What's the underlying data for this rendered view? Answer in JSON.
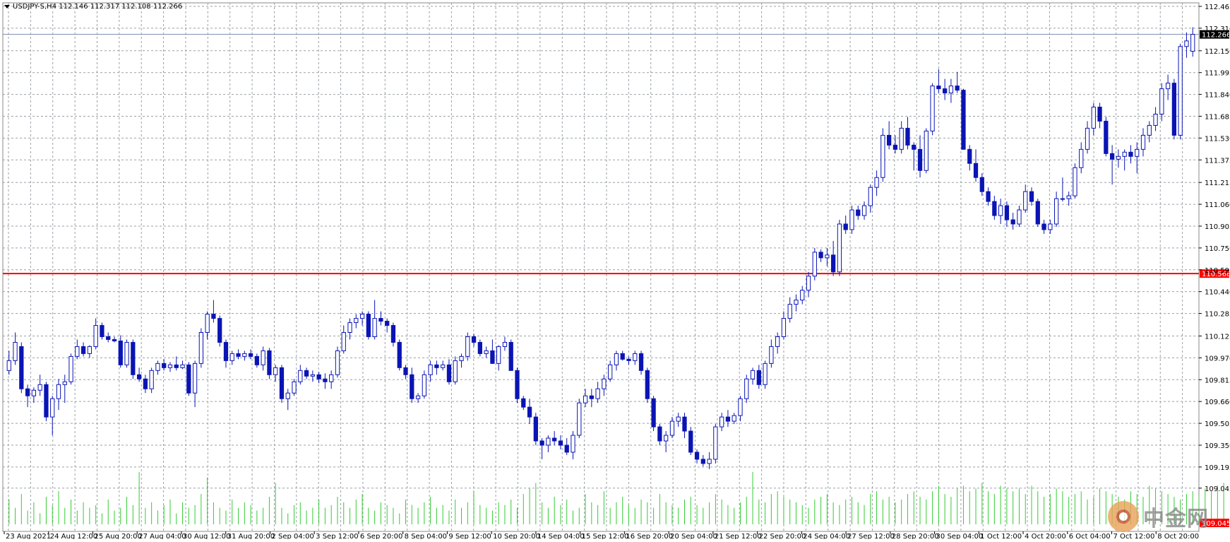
{
  "header": {
    "symbol_line": "USDJPY-S,H4  112.146 112.317 112.108 112.266"
  },
  "watermark": {
    "text": "中金网"
  },
  "colors": {
    "candle": "#0a14b4",
    "grid": "#9aa0a6",
    "hline": "#ff0000",
    "volume": "#33cc33",
    "current_tag_bg": "#000000",
    "hline_tag_bg": "#ff0000"
  },
  "chart_data": {
    "type": "candlestick",
    "symbol": "USDJPY-S",
    "timeframe": "H4",
    "ylim": [
      109.2,
      112.465
    ],
    "y_ticks": [
      112.465,
      112.31,
      112.15,
      111.995,
      111.84,
      111.685,
      111.53,
      111.375,
      111.215,
      111.06,
      110.905,
      110.75,
      110.595,
      110.44,
      110.285,
      110.125,
      109.97,
      109.815,
      109.66,
      109.505,
      109.35,
      109.195,
      109.045
    ],
    "x_labels": [
      "23 Aug 2021",
      "24 Aug 12:00",
      "25 Aug 20:00",
      "27 Aug 04:00",
      "30 Aug 12:00",
      "31 Aug 20:00",
      "2 Sep 04:00",
      "3 Sep 12:00",
      "6 Sep 20:00",
      "8 Sep 04:00",
      "9 Sep 12:00",
      "10 Sep 20:00",
      "14 Sep 04:00",
      "15 Sep 12:00",
      "16 Sep 20:00",
      "20 Sep 04:00",
      "21 Sep 12:00",
      "22 Sep 20:00",
      "24 Sep 04:00",
      "27 Sep 12:00",
      "28 Sep 20:00",
      "30 Sep 04:00",
      "1 Oct 12:00",
      "4 Oct 20:00",
      "6 Oct 04:00",
      "7 Oct 12:00",
      "8 Oct 20:00"
    ],
    "current_price": 112.266,
    "horizontal_line": 110.568,
    "volume_axis_label": "109.045",
    "candles": [
      [
        109.88,
        110.02,
        109.85,
        109.95
      ],
      [
        109.95,
        110.15,
        109.92,
        110.08
      ],
      [
        110.05,
        110.08,
        109.72,
        109.75
      ],
      [
        109.75,
        109.78,
        109.62,
        109.7
      ],
      [
        109.7,
        109.76,
        109.65,
        109.74
      ],
      [
        109.74,
        109.85,
        109.7,
        109.78
      ],
      [
        109.78,
        109.8,
        109.52,
        109.55
      ],
      [
        109.55,
        109.7,
        109.42,
        109.68
      ],
      [
        109.68,
        109.82,
        109.6,
        109.78
      ],
      [
        109.78,
        109.85,
        109.65,
        109.8
      ],
      [
        109.8,
        110.0,
        109.78,
        109.98
      ],
      [
        109.98,
        110.1,
        109.96,
        110.05
      ],
      [
        110.05,
        110.08,
        109.98,
        110.0
      ],
      [
        110.0,
        110.06,
        109.97,
        110.05
      ],
      [
        110.05,
        110.25,
        110.03,
        110.2
      ],
      [
        110.2,
        110.22,
        110.1,
        110.12
      ],
      [
        110.12,
        110.15,
        110.08,
        110.1
      ],
      [
        110.1,
        110.12,
        110.08,
        110.09
      ],
      [
        110.09,
        110.13,
        109.9,
        109.92
      ],
      [
        109.92,
        110.1,
        109.9,
        110.08
      ],
      [
        110.08,
        110.1,
        109.82,
        109.85
      ],
      [
        109.85,
        109.9,
        109.8,
        109.82
      ],
      [
        109.82,
        109.85,
        109.72,
        109.75
      ],
      [
        109.75,
        109.9,
        109.72,
        109.88
      ],
      [
        109.88,
        109.95,
        109.85,
        109.93
      ],
      [
        109.93,
        109.96,
        109.88,
        109.9
      ],
      [
        109.9,
        109.94,
        109.87,
        109.92
      ],
      [
        109.92,
        109.98,
        109.88,
        109.9
      ],
      [
        109.9,
        109.95,
        109.89,
        109.92
      ],
      [
        109.92,
        109.94,
        109.7,
        109.72
      ],
      [
        109.72,
        109.95,
        109.62,
        109.93
      ],
      [
        109.93,
        110.18,
        109.9,
        110.15
      ],
      [
        110.15,
        110.3,
        110.1,
        110.28
      ],
      [
        110.28,
        110.38,
        110.22,
        110.25
      ],
      [
        110.25,
        110.27,
        110.05,
        110.08
      ],
      [
        110.08,
        110.1,
        109.9,
        109.95
      ],
      [
        109.95,
        110.02,
        109.92,
        110.0
      ],
      [
        110.0,
        110.03,
        109.96,
        109.98
      ],
      [
        109.98,
        110.02,
        109.95,
        110.0
      ],
      [
        110.0,
        110.03,
        109.96,
        109.98
      ],
      [
        109.98,
        110.0,
        109.9,
        109.92
      ],
      [
        109.92,
        110.05,
        109.88,
        110.02
      ],
      [
        110.02,
        110.04,
        109.82,
        109.85
      ],
      [
        109.85,
        109.92,
        109.8,
        109.9
      ],
      [
        109.9,
        109.92,
        109.65,
        109.68
      ],
      [
        109.68,
        109.75,
        109.6,
        109.72
      ],
      [
        109.72,
        109.82,
        109.7,
        109.8
      ],
      [
        109.8,
        109.92,
        109.78,
        109.88
      ],
      [
        109.88,
        109.9,
        109.82,
        109.84
      ],
      [
        109.84,
        109.88,
        109.8,
        109.85
      ],
      [
        109.85,
        109.87,
        109.79,
        109.82
      ],
      [
        109.82,
        109.86,
        109.75,
        109.8
      ],
      [
        109.8,
        109.88,
        109.75,
        109.85
      ],
      [
        109.85,
        110.05,
        109.83,
        110.02
      ],
      [
        110.02,
        110.2,
        110.0,
        110.15
      ],
      [
        110.15,
        110.25,
        110.1,
        110.22
      ],
      [
        110.22,
        110.28,
        110.18,
        110.25
      ],
      [
        110.25,
        110.3,
        110.2,
        110.28
      ],
      [
        110.28,
        110.3,
        110.1,
        110.12
      ],
      [
        110.12,
        110.38,
        110.1,
        110.25
      ],
      [
        110.25,
        110.3,
        110.2,
        110.23
      ],
      [
        110.23,
        110.25,
        110.15,
        110.2
      ],
      [
        110.2,
        110.22,
        110.05,
        110.08
      ],
      [
        110.08,
        110.1,
        109.88,
        109.9
      ],
      [
        109.9,
        109.92,
        109.82,
        109.85
      ],
      [
        109.85,
        109.9,
        109.65,
        109.68
      ],
      [
        109.68,
        109.72,
        109.65,
        109.7
      ],
      [
        109.7,
        109.88,
        109.68,
        109.85
      ],
      [
        109.85,
        109.95,
        109.8,
        109.92
      ],
      [
        109.92,
        109.95,
        109.85,
        109.9
      ],
      [
        109.9,
        109.95,
        109.88,
        109.92
      ],
      [
        109.92,
        109.96,
        109.78,
        109.8
      ],
      [
        109.8,
        109.98,
        109.78,
        109.95
      ],
      [
        109.95,
        110.0,
        109.9,
        109.98
      ],
      [
        109.98,
        110.15,
        109.95,
        110.12
      ],
      [
        110.12,
        110.14,
        110.05,
        110.08
      ],
      [
        110.08,
        110.1,
        109.98,
        110.0
      ],
      [
        110.0,
        110.05,
        109.97,
        110.02
      ],
      [
        110.02,
        110.1,
        109.95,
        109.93
      ],
      [
        109.93,
        110.06,
        109.88,
        110.05
      ],
      [
        110.05,
        110.12,
        110.02,
        110.08
      ],
      [
        110.08,
        110.1,
        109.95,
        109.88
      ],
      [
        109.88,
        109.9,
        109.65,
        109.68
      ],
      [
        109.68,
        109.7,
        109.6,
        109.62
      ],
      [
        109.62,
        109.68,
        109.5,
        109.55
      ],
      [
        109.55,
        109.58,
        109.35,
        109.38
      ],
      [
        109.38,
        109.4,
        109.25,
        109.35
      ],
      [
        109.35,
        109.42,
        109.3,
        109.4
      ],
      [
        109.4,
        109.45,
        109.35,
        109.38
      ],
      [
        109.38,
        109.42,
        109.32,
        109.35
      ],
      [
        109.35,
        109.4,
        109.28,
        109.3
      ],
      [
        109.3,
        109.45,
        109.25,
        109.42
      ],
      [
        109.42,
        109.68,
        109.4,
        109.65
      ],
      [
        109.65,
        109.75,
        109.62,
        109.7
      ],
      [
        109.7,
        109.75,
        109.62,
        109.68
      ],
      [
        109.68,
        109.8,
        109.65,
        109.75
      ],
      [
        109.75,
        109.85,
        109.7,
        109.82
      ],
      [
        109.82,
        109.95,
        109.8,
        109.92
      ],
      [
        109.92,
        110.02,
        109.88,
        110.0
      ],
      [
        110.0,
        110.02,
        109.95,
        109.96
      ],
      [
        109.96,
        109.98,
        109.92,
        109.95
      ],
      [
        109.95,
        110.02,
        109.92,
        110.0
      ],
      [
        110.0,
        110.02,
        109.85,
        109.88
      ],
      [
        109.88,
        109.9,
        109.65,
        109.68
      ],
      [
        109.68,
        109.7,
        109.45,
        109.48
      ],
      [
        109.48,
        109.5,
        109.35,
        109.38
      ],
      [
        109.38,
        109.45,
        109.3,
        109.42
      ],
      [
        109.42,
        109.55,
        109.4,
        109.52
      ],
      [
        109.52,
        109.58,
        109.48,
        109.55
      ],
      [
        109.55,
        109.58,
        109.4,
        109.45
      ],
      [
        109.45,
        109.48,
        109.28,
        109.3
      ],
      [
        109.3,
        109.32,
        109.22,
        109.25
      ],
      [
        109.25,
        109.28,
        109.2,
        109.22
      ],
      [
        109.22,
        109.3,
        109.18,
        109.25
      ],
      [
        109.25,
        109.5,
        109.22,
        109.48
      ],
      [
        109.48,
        109.58,
        109.45,
        109.55
      ],
      [
        109.55,
        109.6,
        109.48,
        109.52
      ],
      [
        109.52,
        109.58,
        109.5,
        109.56
      ],
      [
        109.56,
        109.7,
        109.52,
        109.68
      ],
      [
        109.68,
        109.85,
        109.65,
        109.82
      ],
      [
        109.82,
        109.9,
        109.78,
        109.88
      ],
      [
        109.88,
        109.92,
        109.75,
        109.78
      ],
      [
        109.78,
        109.95,
        109.75,
        109.93
      ],
      [
        109.93,
        110.1,
        109.9,
        110.05
      ],
      [
        110.05,
        110.15,
        110.0,
        110.12
      ],
      [
        110.12,
        110.3,
        110.1,
        110.25
      ],
      [
        110.25,
        110.4,
        110.22,
        110.35
      ],
      [
        110.35,
        110.42,
        110.3,
        110.38
      ],
      [
        110.38,
        110.48,
        110.35,
        110.45
      ],
      [
        110.45,
        110.58,
        110.4,
        110.55
      ],
      [
        110.55,
        110.75,
        110.52,
        110.72
      ],
      [
        110.72,
        110.74,
        110.65,
        110.68
      ],
      [
        110.68,
        110.75,
        110.62,
        110.7
      ],
      [
        110.7,
        110.8,
        110.55,
        110.58
      ],
      [
        110.58,
        110.95,
        110.55,
        110.92
      ],
      [
        110.92,
        110.98,
        110.85,
        110.88
      ],
      [
        110.88,
        111.05,
        110.85,
        111.02
      ],
      [
        111.02,
        111.05,
        110.95,
        110.98
      ],
      [
        110.98,
        111.08,
        110.95,
        111.05
      ],
      [
        111.05,
        111.2,
        111.0,
        111.18
      ],
      [
        111.18,
        111.3,
        111.12,
        111.25
      ],
      [
        111.25,
        111.6,
        111.22,
        111.55
      ],
      [
        111.55,
        111.65,
        111.45,
        111.48
      ],
      [
        111.48,
        111.55,
        111.42,
        111.45
      ],
      [
        111.45,
        111.65,
        111.42,
        111.6
      ],
      [
        111.6,
        111.68,
        111.45,
        111.48
      ],
      [
        111.48,
        111.5,
        111.3,
        111.45
      ],
      [
        111.45,
        111.55,
        111.25,
        111.3
      ],
      [
        111.3,
        111.6,
        111.28,
        111.58
      ],
      [
        111.58,
        111.92,
        111.55,
        111.9
      ],
      [
        111.9,
        112.02,
        111.85,
        111.88
      ],
      [
        111.88,
        111.95,
        111.8,
        111.85
      ],
      [
        111.85,
        111.95,
        111.78,
        111.9
      ],
      [
        111.9,
        112.0,
        111.85,
        111.87
      ],
      [
        111.87,
        111.88,
        111.5,
        111.45
      ],
      [
        111.45,
        111.48,
        111.3,
        111.35
      ],
      [
        111.35,
        111.45,
        111.22,
        111.25
      ],
      [
        111.25,
        111.28,
        111.12,
        111.15
      ],
      [
        111.15,
        111.18,
        111.05,
        111.08
      ],
      [
        111.08,
        111.12,
        110.95,
        110.98
      ],
      [
        110.98,
        111.1,
        110.92,
        111.05
      ],
      [
        111.05,
        111.08,
        110.9,
        110.95
      ],
      [
        110.95,
        111.0,
        110.88,
        110.92
      ],
      [
        110.92,
        111.05,
        110.9,
        111.02
      ],
      [
        111.02,
        111.2,
        111.0,
        111.15
      ],
      [
        111.15,
        111.18,
        111.05,
        111.08
      ],
      [
        111.08,
        111.1,
        110.9,
        110.92
      ],
      [
        110.92,
        110.95,
        110.85,
        110.88
      ],
      [
        110.88,
        110.95,
        110.85,
        110.92
      ],
      [
        110.92,
        111.15,
        110.9,
        111.1
      ],
      [
        111.1,
        111.25,
        111.08,
        111.1
      ],
      [
        111.1,
        111.15,
        111.05,
        111.12
      ],
      [
        111.12,
        111.35,
        111.1,
        111.32
      ],
      [
        111.32,
        111.5,
        111.28,
        111.45
      ],
      [
        111.45,
        111.65,
        111.42,
        111.6
      ],
      [
        111.6,
        111.78,
        111.55,
        111.75
      ],
      [
        111.75,
        111.78,
        111.6,
        111.65
      ],
      [
        111.65,
        111.68,
        111.4,
        111.42
      ],
      [
        111.42,
        111.48,
        111.2,
        111.38
      ],
      [
        111.38,
        111.45,
        111.32,
        111.4
      ],
      [
        111.4,
        111.45,
        111.3,
        111.43
      ],
      [
        111.43,
        111.48,
        111.35,
        111.4
      ],
      [
        111.4,
        111.5,
        111.28,
        111.45
      ],
      [
        111.45,
        111.6,
        111.4,
        111.55
      ],
      [
        111.55,
        111.65,
        111.5,
        111.62
      ],
      [
        111.62,
        111.75,
        111.58,
        111.7
      ],
      [
        111.7,
        111.92,
        111.65,
        111.88
      ],
      [
        111.88,
        111.98,
        111.8,
        111.92
      ],
      [
        111.92,
        111.95,
        111.52,
        111.55
      ],
      [
        111.55,
        112.2,
        111.52,
        112.18
      ],
      [
        112.18,
        112.28,
        112.1,
        112.22
      ],
      [
        112.146,
        112.317,
        112.108,
        112.266
      ]
    ],
    "volumes": [
      0.45,
      0.3,
      0.55,
      0.25,
      0.4,
      0.2,
      0.5,
      0.35,
      0.6,
      0.3,
      0.45,
      0.25,
      0.4,
      0.3,
      0.35,
      0.2,
      0.45,
      0.25,
      0.3,
      0.5,
      0.35,
      0.95,
      0.3,
      0.4,
      0.25,
      0.35,
      0.45,
      0.2,
      0.4,
      0.3,
      0.35,
      0.55,
      0.85,
      0.4,
      0.3,
      0.25,
      0.45,
      0.3,
      0.4,
      0.35,
      0.25,
      0.3,
      0.5,
      0.75,
      0.3,
      0.2,
      0.35,
      0.4,
      0.25,
      0.3,
      0.45,
      0.3,
      0.35,
      0.5,
      0.4,
      0.3,
      0.45,
      0.55,
      0.3,
      0.25,
      0.4,
      0.35,
      0.3,
      0.2,
      0.45,
      0.35,
      0.3,
      0.4,
      0.5,
      0.3,
      0.35,
      0.25,
      0.45,
      0.3,
      0.4,
      0.6,
      0.35,
      0.3,
      0.25,
      0.4,
      0.35,
      0.45,
      0.3,
      0.55,
      0.65,
      0.75,
      0.4,
      0.3,
      0.5,
      0.35,
      0.45,
      0.25,
      0.3,
      0.55,
      0.4,
      0.35,
      0.6,
      0.3,
      0.4,
      0.5,
      0.35,
      0.3,
      0.45,
      0.4,
      0.3,
      0.55,
      0.4,
      0.35,
      0.3,
      0.45,
      0.5,
      0.35,
      0.3,
      0.4,
      0.55,
      0.45,
      0.35,
      0.3,
      0.4,
      0.5,
      0.95,
      0.45,
      0.4,
      0.55,
      0.6,
      0.5,
      0.45,
      0.4,
      0.35,
      0.3,
      0.45,
      0.5,
      0.55,
      0.4,
      0.35,
      0.45,
      0.5,
      0.4,
      0.35,
      0.55,
      0.6,
      0.45,
      0.5,
      0.4,
      0.45,
      0.55,
      0.6,
      0.5,
      0.45,
      0.6,
      0.7,
      0.55,
      0.5,
      0.65,
      0.7,
      0.6,
      0.65,
      0.75,
      0.6,
      0.55,
      0.7,
      0.65,
      0.6,
      0.65,
      0.55,
      0.7,
      0.6,
      0.5,
      0.55,
      0.65,
      0.6,
      0.5,
      0.55,
      0.6,
      0.45,
      0.5,
      0.65,
      0.6,
      0.55,
      0.5,
      0.45,
      0.6,
      0.55,
      0.5,
      0.7,
      0.65,
      0.6,
      0.55,
      0.5,
      0.45,
      0.55,
      0.6,
      0.5,
      0.65,
      0.6,
      0.7,
      0.75
    ]
  }
}
